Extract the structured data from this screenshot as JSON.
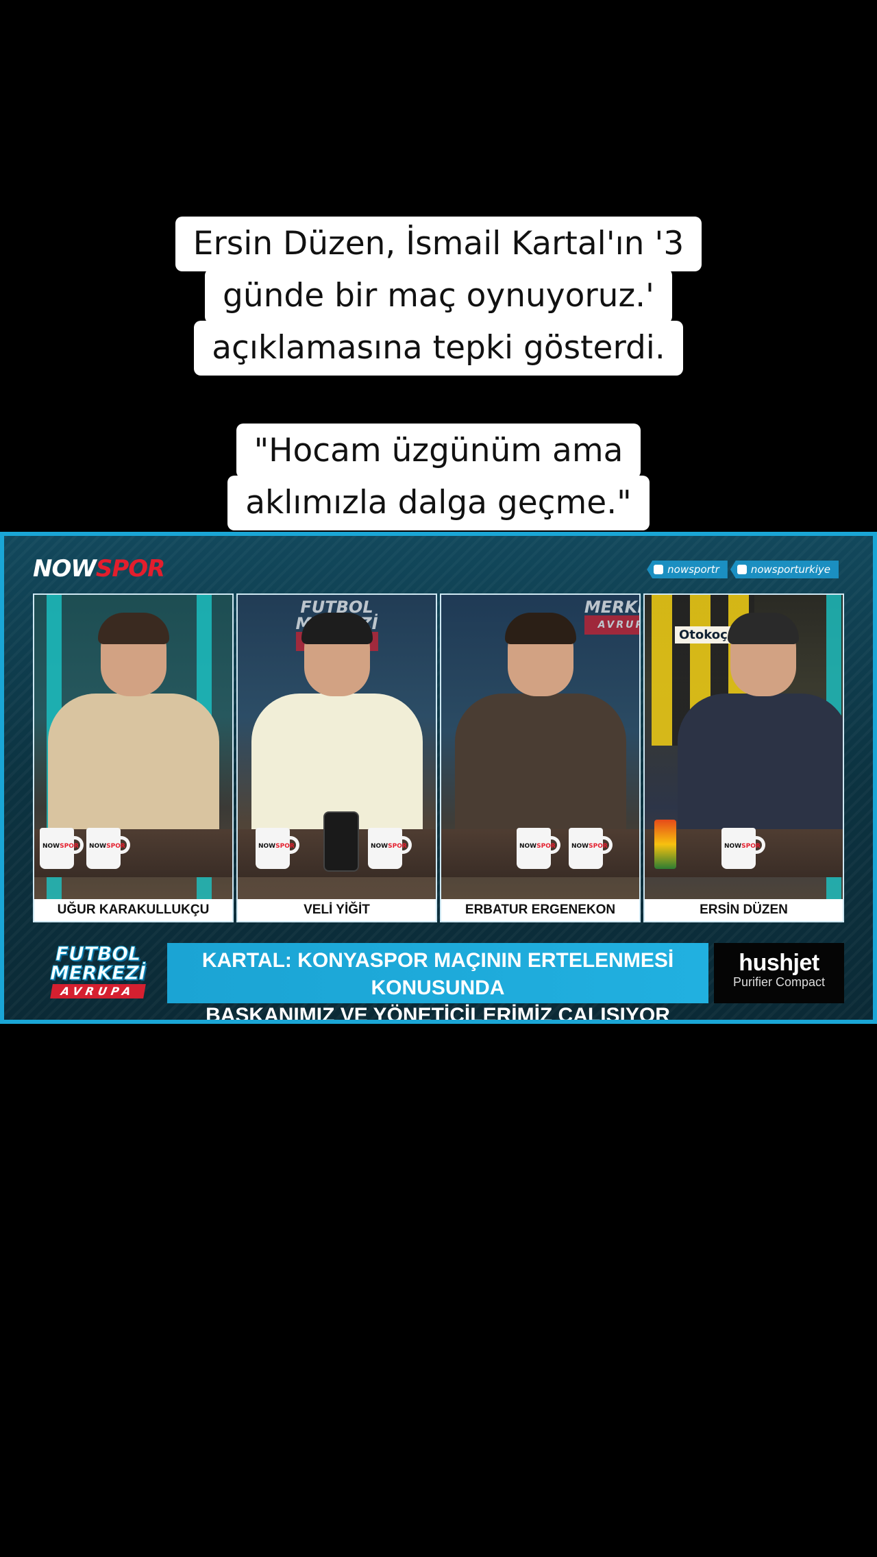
{
  "caption_top": {
    "lines": [
      "Ersin Düzen, İsmail Kartal'ın '3",
      "günde bir maç oynuyoruz.'",
      "açıklamasına tepki gösterdi."
    ]
  },
  "caption_quote": {
    "lines": [
      "\"Hocam üzgünüm ama",
      "aklımızla dalga geçme.\""
    ]
  },
  "broadcast": {
    "channel_logo": {
      "now": "NOW",
      "spor": "SPOR"
    },
    "socials": [
      {
        "icon": "x-icon",
        "handle": "nowsportr"
      },
      {
        "icon": "instagram-tiktok-icon",
        "handle": "nowsporturkiye"
      }
    ],
    "panelists": [
      {
        "name": "UĞUR KARAKULLUKÇU",
        "shirt": "#d9c4a0",
        "hair": "#3a2a20"
      },
      {
        "name": "VELİ YİĞİT",
        "shirt": "#f1eed7",
        "hair": "#1d1d1d"
      },
      {
        "name": "ERBATUR ERGENEKON",
        "shirt": "#4a3d33",
        "hair": "#2b1f16"
      },
      {
        "name": "ERSİN DÜZEN",
        "shirt": "#2c3345",
        "hair": "#2a2a2a"
      }
    ],
    "wall_sign": {
      "line1": "FUTBOL",
      "line2": "MERKEZİ",
      "line3": "AVRUPA"
    },
    "jersey_sponsor": "Otokoç",
    "mug_logo": {
      "now": "NOW",
      "spor": "SPOR"
    },
    "show_logo": {
      "line1": "FUTBOL",
      "line2": "MERKEZİ",
      "line3": "AVRUPA"
    },
    "headline": {
      "line1": "KARTAL: KONYASPOR MAÇININ ERTELENMESİ KONUSUNDA",
      "line2": "BAŞKANIMIZ VE YÖNETİCİLERİMİZ ÇALIŞIYOR"
    },
    "sponsor": {
      "brand": "hushjet",
      "sub": "Purifier Compact"
    },
    "colors": {
      "accent": "#1aa6d6",
      "brand_red": "#e31e2d"
    }
  }
}
